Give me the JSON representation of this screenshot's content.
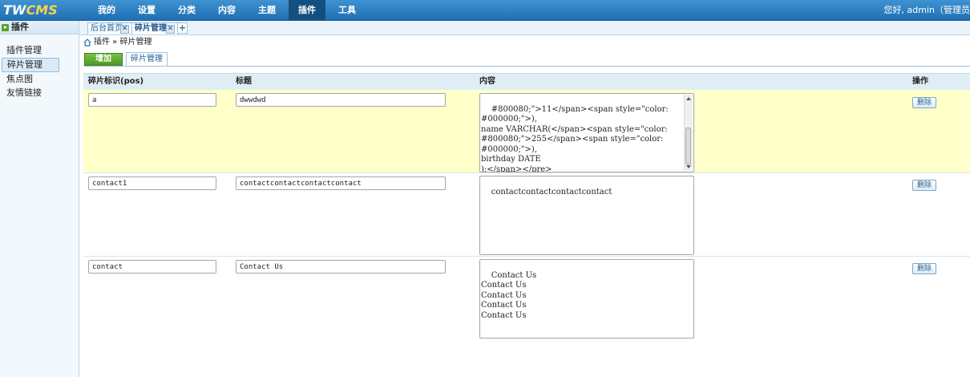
{
  "app": {
    "logo_text_a": "TW",
    "logo_text_b": "CMS",
    "greeting": "您好, admin（管理员"
  },
  "nav": [
    "我的",
    "设置",
    "分类",
    "内容",
    "主题",
    "插件",
    "工具"
  ],
  "sidebar": {
    "title": "插件",
    "items": [
      "插件管理",
      "碎片管理",
      "焦点图",
      "友情链接"
    ]
  },
  "tabs": [
    {
      "label": "后台首页"
    },
    {
      "label": "碎片管理"
    }
  ],
  "tab_add_label": "+",
  "tab_close_label": "✕",
  "breadcrumb": "插件 » 碎片管理",
  "toolbar": {
    "add_label": "增加",
    "subtab_label": "碎片管理"
  },
  "table": {
    "headers": {
      "pos": "碎片标识(pos)",
      "title": "标题",
      "content": "内容",
      "actions": "操作"
    },
    "delete_label": "删除",
    "rows": [
      {
        "pos": "a",
        "title": "dwwdwd",
        "content": "#800080;\">11</span><span style=\"color:\n#000000;\">),\nname VARCHAR(</span><span style=\"color:\n#800080;\">255</span><span style=\"color:\n#000000;\">),\nbirthday DATE\n);</span></pre>\n</div>"
      },
      {
        "pos": "contact1",
        "title": "contactcontactcontactcontact",
        "content": "contactcontactcontactcontact"
      },
      {
        "pos": "contact",
        "title": "Contact Us",
        "content": "Contact Us\nContact Us\nContact Us\nContact Us\nContact Us"
      }
    ]
  },
  "colors": {
    "topbar": "#2a7dc2",
    "highlight_row": "#ffffc9",
    "add_button": "#5aa02c"
  }
}
